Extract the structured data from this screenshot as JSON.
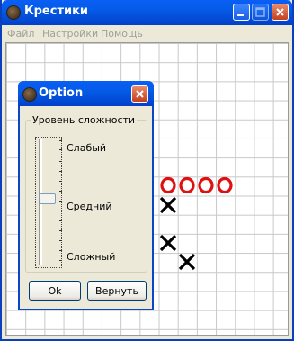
{
  "window": {
    "title": "Крестики"
  },
  "menu": {
    "items": [
      "Файл",
      "Настройки",
      "Помощь"
    ]
  },
  "board": {
    "marks": [
      {
        "type": "o",
        "row": 7,
        "col": 8
      },
      {
        "type": "o",
        "row": 7,
        "col": 9
      },
      {
        "type": "o",
        "row": 7,
        "col": 10
      },
      {
        "type": "o",
        "row": 7,
        "col": 11
      },
      {
        "type": "x",
        "row": 8,
        "col": 8
      },
      {
        "type": "x",
        "row": 10,
        "col": 8
      },
      {
        "type": "x",
        "row": 11,
        "col": 9
      }
    ],
    "colors": {
      "o": "#e01010",
      "x": "#000000"
    }
  },
  "dialog": {
    "title": "Option",
    "group_label": "Уровень сложности",
    "levels": [
      "Слабый",
      "Средний",
      "Сложный"
    ],
    "slider_value_fraction": 0.5,
    "ok_label": "Ok",
    "back_label": "Вернуть"
  }
}
